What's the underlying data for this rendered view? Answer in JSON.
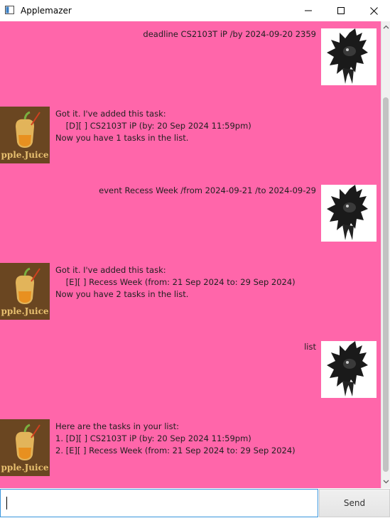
{
  "window": {
    "title": "Applemazer"
  },
  "messages": [
    {
      "role": "user",
      "text": "deadline CS2103T iP /by 2024-09-20 2359"
    },
    {
      "role": "bot",
      "text": "Got it. I've added this task:\n    [D][ ] CS2103T iP (by: 20 Sep 2024 11:59pm)\nNow you have 1 tasks in the list."
    },
    {
      "role": "user",
      "text": "event Recess Week /from 2024-09-21 /to 2024-09-29"
    },
    {
      "role": "bot",
      "text": "Got it. I've added this task:\n    [E][ ] Recess Week (from: 21 Sep 2024 to: 29 Sep 2024)\nNow you have 2 tasks in the list."
    },
    {
      "role": "user",
      "text": "list"
    },
    {
      "role": "bot",
      "text": "Here are the tasks in your list:\n1. [D][ ] CS2103T iP (by: 20 Sep 2024 11:59pm)\n2. [E][ ] Recess Week (from: 21 Sep 2024 to: 29 Sep 2024)"
    }
  ],
  "avatars": {
    "bot_logo_text": "pple.Juice"
  },
  "input": {
    "value": "",
    "placeholder": ""
  },
  "send": {
    "label": "Send"
  },
  "colors": {
    "chat_background": "#ff66aa",
    "input_focus_border": "#3a96dd"
  }
}
